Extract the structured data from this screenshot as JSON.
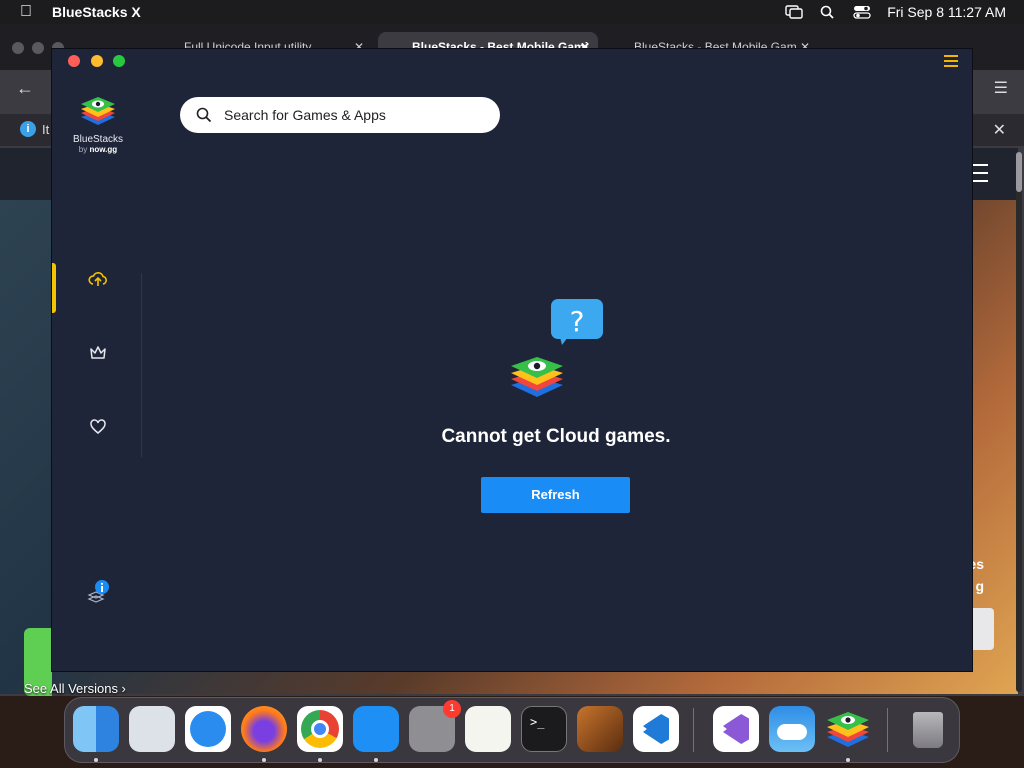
{
  "menubar": {
    "app_name": "BlueStacks X",
    "datetime": "Fri Sep 8  11:27 AM"
  },
  "browser": {
    "tabs": [
      {
        "label": "Full Unicode Input utility",
        "icon": "keyboard-icon"
      },
      {
        "label": "BlueStacks - Best Mobile Gami",
        "icon": "bluestacks-icon"
      },
      {
        "label": "BlueStacks - Best Mobile Gam",
        "icon": "bluestacks-icon"
      }
    ],
    "infobar_text": "It",
    "see_all_versions": "See All Versions ›",
    "right_text_1": "es",
    "right_text_2": "g"
  },
  "bluestacks": {
    "logo": {
      "name": "BlueStacks",
      "by": "by",
      "brand": "now.gg"
    },
    "search": {
      "placeholder": "Search for Games & Apps"
    },
    "sidebar": {
      "items": [
        {
          "name": "cloud-games",
          "icon": "cloud-upload-icon",
          "active": true
        },
        {
          "name": "premium",
          "icon": "crown-icon",
          "active": false
        },
        {
          "name": "favorites",
          "icon": "heart-icon",
          "active": false
        }
      ],
      "bottom_icon": "info-stack-icon"
    },
    "error": {
      "message": "Cannot get Cloud games.",
      "bubble_glyph": "?",
      "refresh_label": "Refresh"
    },
    "accent_color": "#1a8cf5",
    "active_color": "#f5c400"
  },
  "dock": {
    "apps": [
      {
        "name": "finder"
      },
      {
        "name": "launchpad"
      },
      {
        "name": "safari"
      },
      {
        "name": "firefox"
      },
      {
        "name": "chrome"
      },
      {
        "name": "app-store"
      },
      {
        "name": "system-settings",
        "badge": "1"
      },
      {
        "name": "textedit"
      },
      {
        "name": "terminal"
      },
      {
        "name": "garageband"
      },
      {
        "name": "vscode"
      },
      {
        "name": "visual-studio"
      },
      {
        "name": "weather"
      },
      {
        "name": "bluestacks"
      },
      {
        "name": "trash"
      }
    ]
  }
}
